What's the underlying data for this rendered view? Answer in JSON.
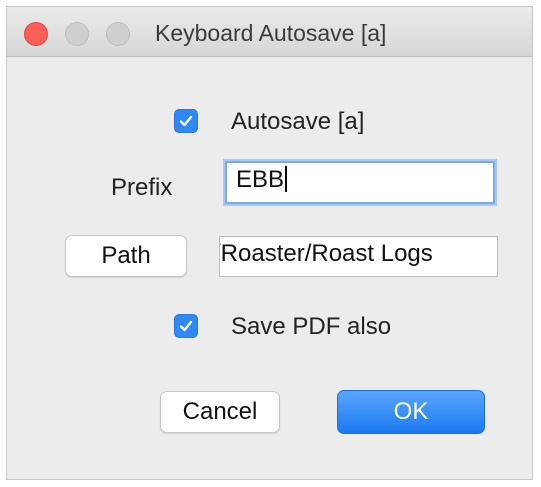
{
  "window": {
    "title": "Keyboard Autosave [a]"
  },
  "autosave": {
    "checked": true,
    "label": "Autosave [a]"
  },
  "prefix": {
    "label": "Prefix",
    "value": "EBB"
  },
  "path": {
    "button_label": "Path",
    "value": "/Roaster/Roast Logs"
  },
  "save_pdf": {
    "checked": true,
    "label": "Save PDF also"
  },
  "buttons": {
    "cancel": "Cancel",
    "ok": "OK"
  },
  "colors": {
    "accent": "#2f88f3",
    "close_button": "#fc5f57",
    "focus_ring": "#79aaf1"
  }
}
